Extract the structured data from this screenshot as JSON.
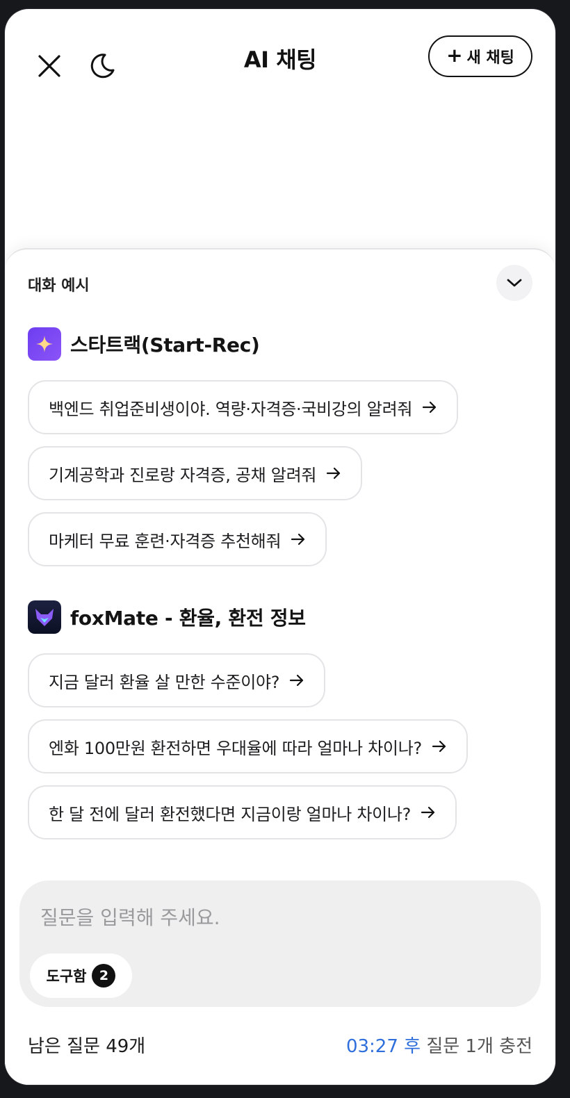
{
  "header": {
    "title": "AI 채팅",
    "new_chat_label": "새 채팅",
    "icons": [
      "close-icon",
      "moon-icon",
      "plus-icon"
    ]
  },
  "sheet": {
    "title": "대화 예시",
    "collapse_icon": "chevron-down-icon",
    "agents": [
      {
        "name": "스타트랙(Start-Rec)",
        "logo_icon": "sparkle-logo-icon",
        "prompts": [
          "백엔드 취업준비생이야. 역량·자격증·국비강의 알려줘",
          "기계공학과 진로랑 자격증, 공채 알려줘",
          "마케터 무료 훈련·자격증 추천해줘"
        ]
      },
      {
        "name": "foxMate - 환율, 환전 정보",
        "logo_icon": "fox-logo-icon",
        "prompts": [
          "지금 달러 환율 살 만한 수준이야?",
          "엔화 100만원 환전하면 우대율에 따라 얼마나 차이나?",
          "한 달 전에 달러 환전했다면 지금이랑 얼마나 차이나?"
        ]
      }
    ]
  },
  "composer": {
    "placeholder": "질문을 입력해 주세요.",
    "value": "",
    "toolbox_label": "도구함",
    "toolbox_count": "2"
  },
  "footer": {
    "remaining": "남은 질문 49개",
    "timer": "03:27 후",
    "recharge": " 질문 1개 충전"
  },
  "colors": {
    "accent_blue": "#2f6fdc",
    "startrec_purple": "#7444f3",
    "foxmate_navy": "#141a33"
  }
}
